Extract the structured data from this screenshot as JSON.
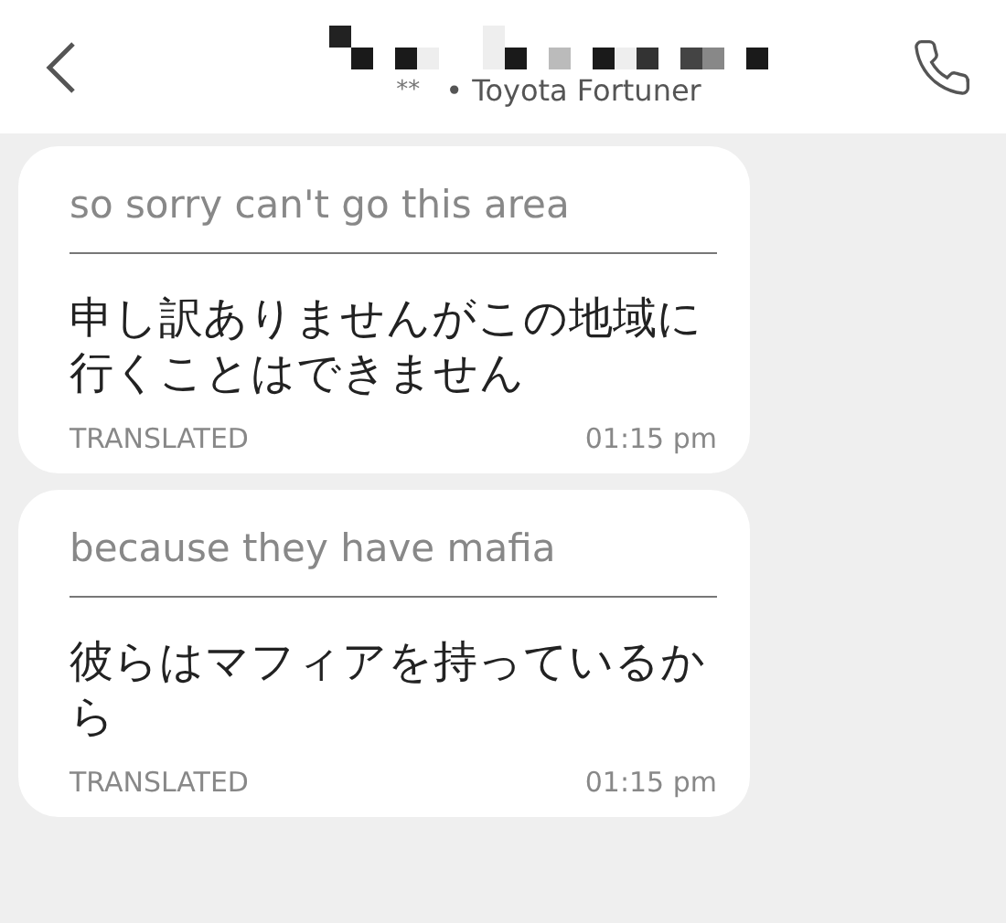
{
  "header": {
    "subtitle_prefix": "**",
    "subtitle": "• Toyota Fortuner"
  },
  "messages": [
    {
      "original": "so sorry can't go this area",
      "translation": "申し訳ありませんがこの地域に行くことはできません",
      "label": "TRANSLATED",
      "time": "01:15 pm"
    },
    {
      "original": "because they have mafia",
      "translation": "彼らはマフィアを持っているから",
      "label": "TRANSLATED",
      "time": "01:15 pm"
    }
  ]
}
